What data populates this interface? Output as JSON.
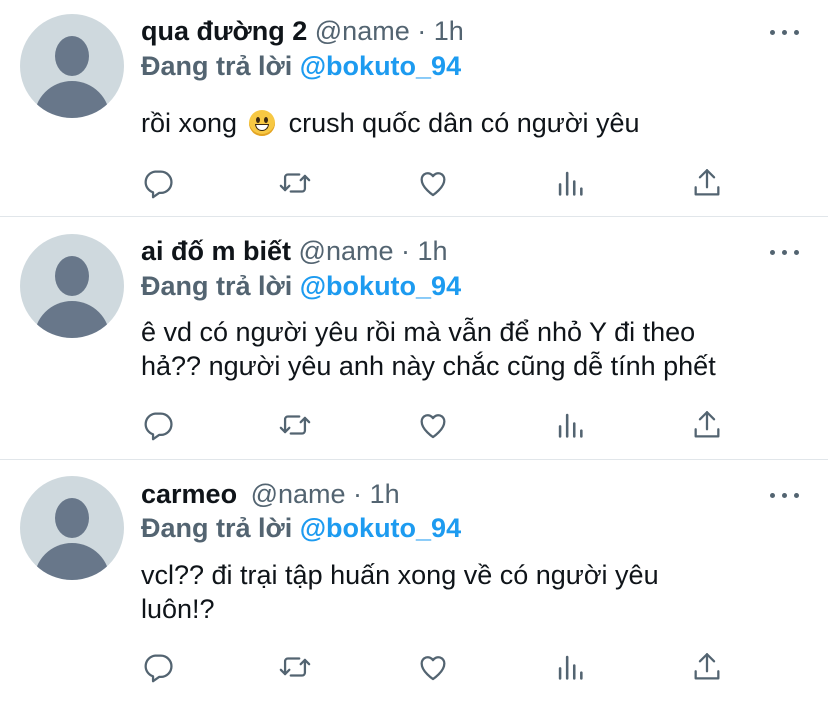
{
  "tweets": [
    {
      "display_name": "qua đường 2",
      "handle": "@name",
      "separator": "·",
      "time": "1h",
      "reply_prefix": "Đang trả lời",
      "reply_to": "@bokuto_94",
      "text_before_emoji": "rồi xong",
      "emoji": "grinning-face-emoji",
      "text_after_emoji": "crush quốc dân có người yêu"
    },
    {
      "display_name": "ai đố m biết",
      "handle": "@name",
      "separator": "·",
      "time": "1h",
      "reply_prefix": "Đang trả lời",
      "reply_to": "@bokuto_94",
      "text_line1": "ê vd có người yêu rồi mà vẫn để nhỏ Y đi theo",
      "text_line2": "hả?? người yêu anh này chắc cũng dễ tính phết"
    },
    {
      "display_name": "carmeo",
      "handle": "@name",
      "separator": "·",
      "time": "1h",
      "reply_prefix": "Đang trả lời",
      "reply_to": "@bokuto_94",
      "text_line1": "vcl?? đi trại tập huấn xong về có người yêu",
      "text_line2": "luôn!?"
    }
  ],
  "icons": [
    "more-icon",
    "reply-icon",
    "retweet-icon",
    "like-icon",
    "analytics-icon",
    "share-icon"
  ],
  "colors": {
    "link": "#1d9bf0",
    "secondary_text": "#536471",
    "text": "#0f1419",
    "avatar_bg": "#cfd9de"
  }
}
